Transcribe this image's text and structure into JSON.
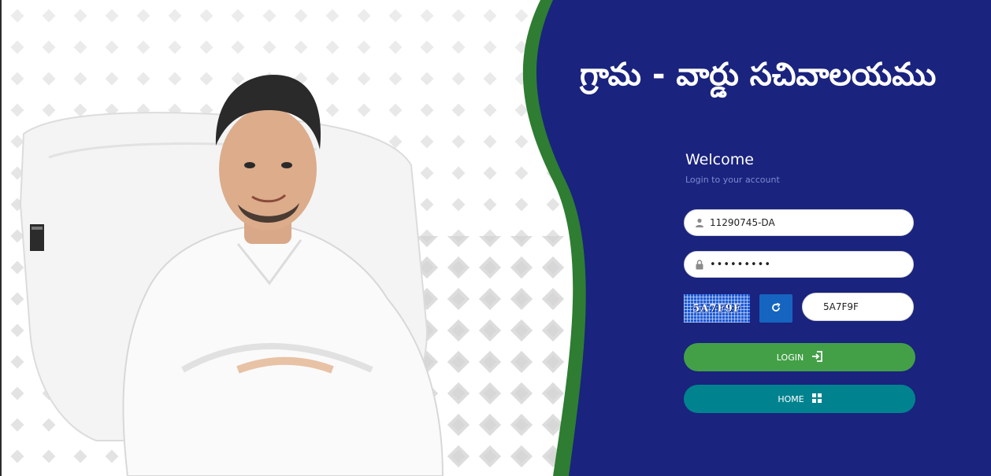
{
  "header": {
    "title": "గ్రామ - వార్డు సచివాలయము"
  },
  "login": {
    "welcome": "Welcome",
    "subtitle": "Login to your account",
    "username_value": "11290745-DA",
    "password_value": "•••••••••",
    "captcha_text": "5A7F9F",
    "captcha_input_value": "5A7F9F",
    "login_label": "LOGIN",
    "home_label": "HOME"
  },
  "icons": {
    "user": "user-icon",
    "lock": "lock-icon",
    "refresh": "refresh-icon",
    "login": "sign-in-icon",
    "home": "grid-icon"
  },
  "colors": {
    "panel_bg": "#1a237e",
    "accent_green": "#2e7d32",
    "login_button": "#43a047",
    "home_button": "#00838f",
    "refresh_button": "#1565c0"
  }
}
